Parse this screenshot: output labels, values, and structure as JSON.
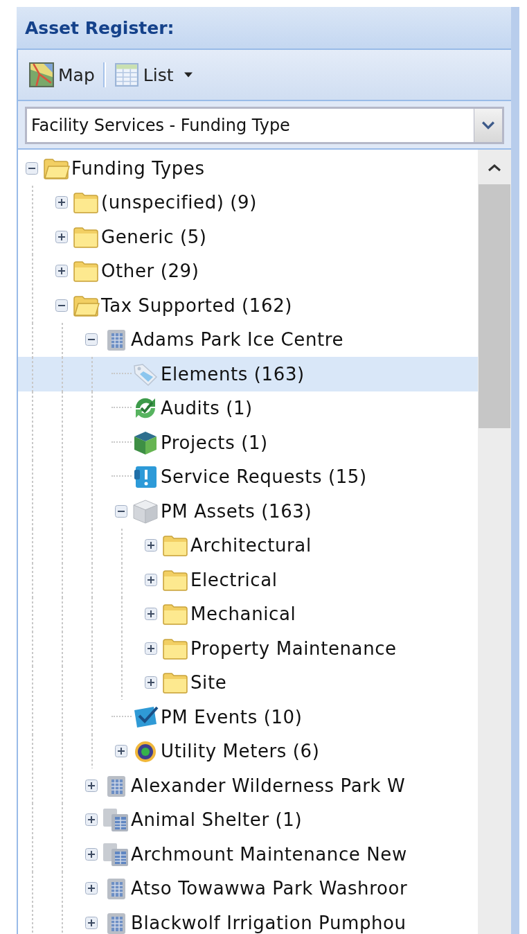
{
  "panel": {
    "title": "Asset Register:"
  },
  "toolbar": {
    "buttons": [
      {
        "kind": "map",
        "label": "Map"
      },
      {
        "kind": "list",
        "label": "List"
      }
    ]
  },
  "view_select": {
    "value": "Facility Services - Funding Type"
  },
  "tree": {
    "items": [
      {
        "label": "Funding Types",
        "kind": "folder",
        "expanded": true,
        "selected": false,
        "children": [
          {
            "label": "(unspecified) (9)",
            "kind": "folder",
            "expanded": false,
            "selected": false
          },
          {
            "label": "Generic (5)",
            "kind": "folder",
            "expanded": false,
            "selected": false
          },
          {
            "label": "Other (29)",
            "kind": "folder",
            "expanded": false,
            "selected": false
          },
          {
            "label": "Tax Supported (162)",
            "kind": "folder",
            "expanded": true,
            "selected": false,
            "children": [
              {
                "label": "Adams Park Ice Centre",
                "kind": "building",
                "expanded": true,
                "selected": false,
                "children": [
                  {
                    "label": "Elements (163)",
                    "kind": "tag",
                    "selected": true
                  },
                  {
                    "label": "Audits (1)",
                    "kind": "audit",
                    "selected": false
                  },
                  {
                    "label": "Projects (1)",
                    "kind": "project",
                    "selected": false
                  },
                  {
                    "label": "Service Requests (15)",
                    "kind": "request",
                    "selected": false
                  },
                  {
                    "label": "PM Assets (163)",
                    "kind": "pm-assets",
                    "expanded": true,
                    "selected": false,
                    "children": [
                      {
                        "label": "Architectural",
                        "kind": "folder",
                        "expanded": false,
                        "selected": false
                      },
                      {
                        "label": "Electrical",
                        "kind": "folder",
                        "expanded": false,
                        "selected": false
                      },
                      {
                        "label": "Mechanical",
                        "kind": "folder",
                        "expanded": false,
                        "selected": false
                      },
                      {
                        "label": "Property Maintenance",
                        "kind": "folder",
                        "expanded": false,
                        "selected": false
                      },
                      {
                        "label": "Site",
                        "kind": "folder",
                        "expanded": false,
                        "selected": false
                      }
                    ]
                  },
                  {
                    "label": "PM Events (10)",
                    "kind": "pm-events",
                    "selected": false
                  },
                  {
                    "label": "Utility Meters (6)",
                    "kind": "meter",
                    "expanded": false,
                    "selected": false
                  }
                ]
              },
              {
                "label": "Alexander Wilderness Park W",
                "kind": "building",
                "expanded": false,
                "selected": false
              },
              {
                "label": "Animal Shelter (1)",
                "kind": "buildings",
                "expanded": false,
                "selected": false
              },
              {
                "label": "Archmount Maintenance New",
                "kind": "buildings",
                "expanded": false,
                "selected": false
              },
              {
                "label": "Atso Towawwa Park Washroor",
                "kind": "building",
                "expanded": false,
                "selected": false
              },
              {
                "label": "Blackwolf Irrigation Pumphou",
                "kind": "building",
                "expanded": false,
                "selected": false
              }
            ]
          }
        ]
      }
    ]
  }
}
